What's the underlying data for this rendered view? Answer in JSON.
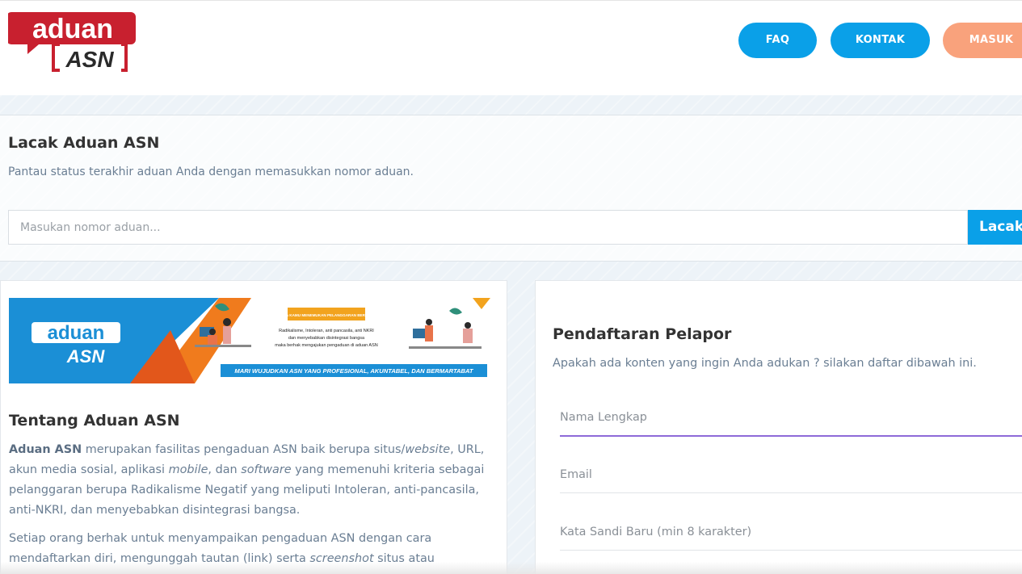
{
  "header": {
    "logo_text_top": "aduan",
    "logo_text_bottom": "ASN",
    "nav": [
      {
        "label": "FAQ"
      },
      {
        "label": "KONTAK"
      },
      {
        "label": "MASUK"
      }
    ]
  },
  "track": {
    "title": "Lacak Aduan ASN",
    "subtitle": "Pantau status terakhir aduan Anda dengan memasukkan nomor aduan.",
    "input_placeholder": "Masukan nomor aduan...",
    "button_label": "Lacak"
  },
  "banner": {
    "logo_top": "aduan",
    "logo_bottom": "ASN",
    "notice_title": "JIKA KAMU MENEMUKAN PELANGGARAN BERUPA",
    "notice_line1": "Radikalisme, Intoleran, anti pancasila, anti NKRI",
    "notice_line2": "dan menyebabkan disintegrasi bangsa",
    "notice_line3": "maka berhak mengajukan pengaduan di aduan ASN",
    "tagline": "MARI WUJUDKAN ASN YANG PROFESIONAL, AKUNTABEL, DAN BERMARTABAT"
  },
  "about": {
    "title": "Tentang Aduan ASN",
    "p1_bold": "Aduan ASN",
    "p1_a": " merupakan fasilitas pengaduan ASN baik berupa situs/",
    "p1_website": "website",
    "p1_b": ", URL, akun media sosial, aplikasi ",
    "p1_mobile": "mobile",
    "p1_c": ", dan ",
    "p1_software": "software",
    "p1_d": " yang memenuhi kriteria sebagai pelanggaran berupa Radikalisme Negatif yang meliputi Intoleran, anti-pancasila, anti-NKRI, dan menyebabkan disintegrasi bangsa.",
    "p2_a": "Setiap orang berhak untuk menyampaikan pengaduan ASN dengan cara mendaftarkan diri, mengunggah tautan (link) serta ",
    "p2_screenshot": "screenshot",
    "p2_b": " situs atau"
  },
  "register": {
    "title": "Pendaftaran Pelapor",
    "subtitle": "Apakah ada konten yang ingin Anda adukan ? silakan daftar dibawah ini.",
    "fields": [
      {
        "placeholder": "Nama Lengkap"
      },
      {
        "placeholder": "Email"
      },
      {
        "placeholder": "Kata Sandi Baru (min 8 karakter)"
      }
    ]
  },
  "colors": {
    "accent_blue": "#0aa0e8",
    "masuk_orange": "#f9a27c",
    "logo_red": "#c8202f",
    "focus_purple": "#8e6ad8"
  }
}
